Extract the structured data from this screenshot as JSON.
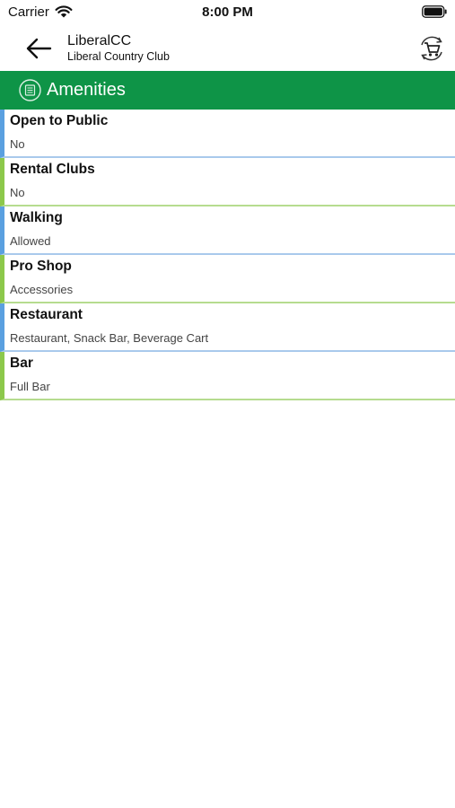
{
  "status_bar": {
    "carrier": "Carrier",
    "time": "8:00 PM"
  },
  "nav": {
    "title": "LiberalCC",
    "subtitle": "Liberal Country Club",
    "back_icon": "arrow-left-icon",
    "action_icon": "cart-refresh-icon"
  },
  "section": {
    "title": "Amenities",
    "icon": "list-icon",
    "color": "#0e9447"
  },
  "amenities": [
    {
      "label": "Open to Public",
      "value": "No"
    },
    {
      "label": "Rental Clubs",
      "value": "No"
    },
    {
      "label": "Walking",
      "value": "Allowed"
    },
    {
      "label": "Pro Shop",
      "value": "Accessories"
    },
    {
      "label": "Restaurant",
      "value": "Restaurant, Snack Bar, Beverage Cart"
    },
    {
      "label": "Bar",
      "value": "Full Bar"
    }
  ],
  "colors": {
    "accent_blue": "#5aa0e0",
    "accent_green": "#8cc84b"
  }
}
